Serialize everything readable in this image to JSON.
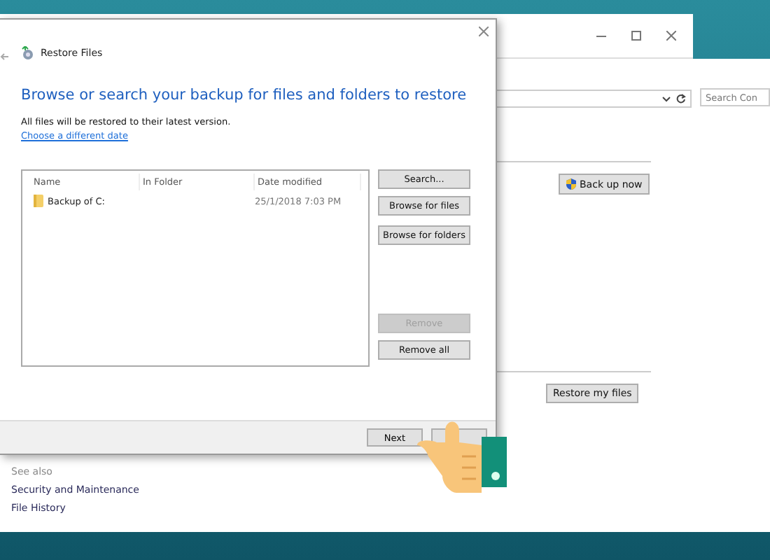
{
  "back_window": {
    "search": {
      "placeholder": "Search Con"
    },
    "buttons": [
      {
        "label": "Back up now",
        "kind": "shield"
      },
      {
        "label": "Restore my files",
        "kind": "plain"
      }
    ],
    "see_also": {
      "heading": "See also",
      "links": [
        "Security and Maintenance",
        "File History"
      ]
    }
  },
  "dialog": {
    "title": "Restore Files",
    "heading": "Browse or search your backup for files and folders to restore",
    "note": "All files will be restored to their latest version.",
    "link": "Choose a different date",
    "table": {
      "columns": [
        "Name",
        "In Folder",
        "Date modified"
      ],
      "rows": [
        {
          "name": "Backup of C:",
          "date": "25/1/2018 7:03 PM"
        }
      ]
    },
    "side_buttons": [
      {
        "label": "Search...",
        "disabled": false
      },
      {
        "label": "Browse for files",
        "disabled": false
      },
      {
        "label": "Browse for folders",
        "disabled": false
      },
      {
        "label": "Remove",
        "disabled": true
      },
      {
        "label": "Remove all",
        "disabled": false
      }
    ],
    "footer_buttons": [
      "Next"
    ]
  }
}
